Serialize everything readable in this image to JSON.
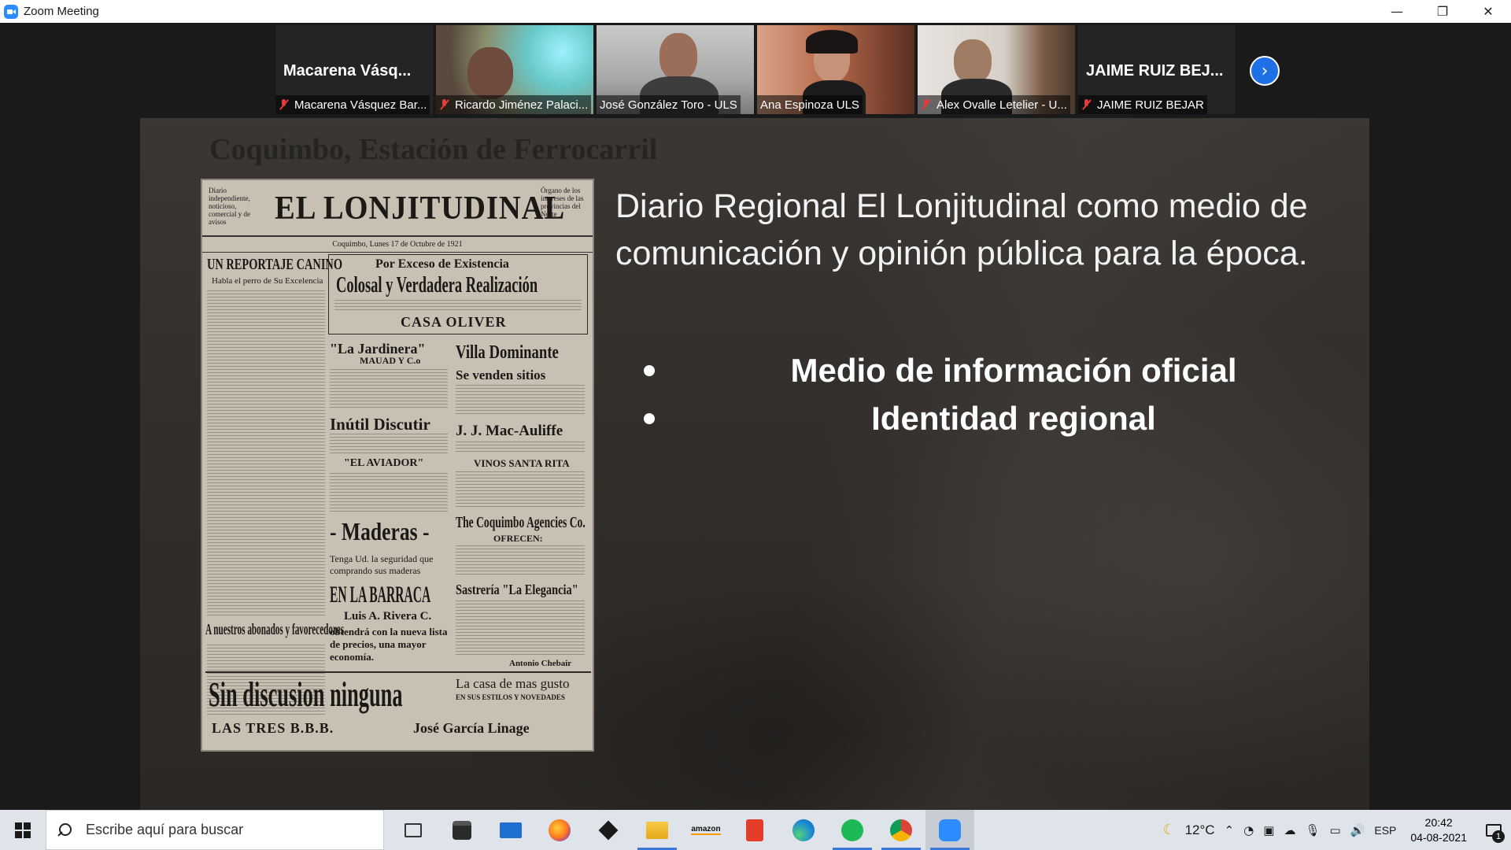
{
  "window": {
    "title": "Zoom Meeting",
    "minimize": "—",
    "restore": "❐",
    "close": "✕"
  },
  "participants": [
    {
      "display_name": "Macarena Vásq...",
      "label": "Macarena Vásquez Bar...",
      "muted": true,
      "video": false
    },
    {
      "display_name": "",
      "label": "Ricardo Jiménez Palaci...",
      "muted": true,
      "video": true
    },
    {
      "display_name": "",
      "label": "José González Toro - ULS",
      "muted": false,
      "video": true,
      "active": true
    },
    {
      "display_name": "",
      "label": "Ana Espinoza ULS",
      "muted": false,
      "video": true
    },
    {
      "display_name": "",
      "label": "Alex Ovalle Letelier - U...",
      "muted": true,
      "video": true
    },
    {
      "display_name": "JAIME RUIZ BEJ...",
      "label": "JAIME RUIZ BEJAR",
      "muted": true,
      "video": false
    }
  ],
  "next_page_icon": "chevron-right-icon",
  "slide": {
    "heading": "Coquimbo, Estación de Ferrocarril",
    "title": "Diario Regional El Lonjitudinal como medio de comunicación y opinión pública para la época.",
    "bullets": [
      "Medio de información oficial",
      "Identidad regional"
    ],
    "newspaper": {
      "masthead": "EL LONJITUDINAL",
      "left_note": "Diario independiente, noticioso, comercial y de avisos",
      "right_note": "Órgano de los intereses de las provincias del Norte",
      "dateline": "Coquimbo, Lunes 17 de Octubre de 1921",
      "headlines": {
        "reportaje": "UN REPORTAJE CANINO",
        "reportaje_sub": "Habla el perro de Su Excelencia",
        "exceso": "Por Exceso de Existencia",
        "colosal": "Colosal y Verdadera Realización",
        "oliver": "CASA OLIVER",
        "jardinera": "\"La Jardinera\"",
        "mauad": "MAUAD Y C.o",
        "villa": "Villa Dominante",
        "venden": "Se venden sitios",
        "inutil": "Inútil Discutir",
        "aviador": "\"EL AVIADOR\"",
        "mac": "J. J. Mac-Auliffe",
        "vinos": "VINOS SANTA RITA",
        "maderas": "- Maderas -",
        "tenga": "Tenga Ud. la seguridad que comprando sus maderas",
        "barraca": "EN LA BARRACA",
        "rivera": "Luis A. Rivera C.",
        "coquimbo_ag": "The Coquimbo Agencies Co.",
        "ofrecen": "OFRECEN:",
        "sastreria": "Sastrería \"La Elegancia\"",
        "abonados": "A nuestros abonados y favorecedores",
        "obtendra": "obtendrá con la nueva lista de precios, una mayor economía.",
        "chebair": "Antonio Chebair",
        "sin": "Sin discusion ninguna",
        "casa_gusto": "La casa de mas gusto",
        "estilos": "EN SUS ESTILOS Y NOVEDADES",
        "tres": "LAS TRES B.B.B.",
        "garcia": "José García Linage"
      }
    }
  },
  "taskbar": {
    "search_placeholder": "Escribe aquí para buscar",
    "apps": [
      "task-view-icon",
      "store-icon",
      "mail-icon",
      "firefox-icon",
      "dropbox-icon",
      "file-explorer-icon",
      "amazon-icon",
      "office-icon",
      "edge-icon",
      "spotify-icon",
      "chrome-icon",
      "zoom-icon"
    ],
    "amazon_label": "amazon",
    "weather_temp": "12°C",
    "language": "ESP",
    "time": "20:42",
    "date": "04-08-2021",
    "notifications": "1"
  }
}
